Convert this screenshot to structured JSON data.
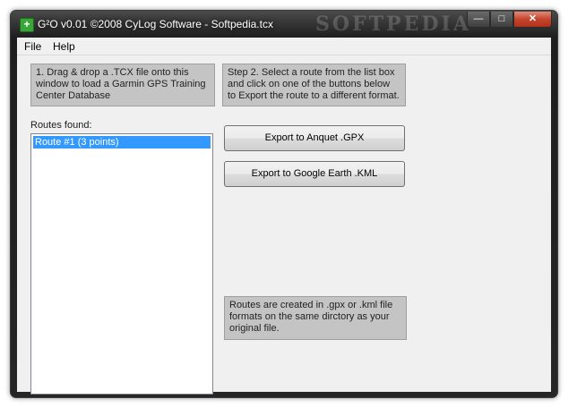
{
  "window": {
    "title": "G²O v0.01 ©2008 CyLog Software - Softpedia.tcx",
    "watermark": "SOFTPEDIA"
  },
  "menu": {
    "items": [
      {
        "label": "File"
      },
      {
        "label": "Help"
      }
    ]
  },
  "step1": {
    "text": "1. Drag & drop a .TCX file onto this window to load a Garmin GPS Training Center Database"
  },
  "step2": {
    "text": "Step 2. Select a route from the list box and click on one of the buttons below to Export the route to a different format."
  },
  "routes": {
    "label": "Routes found:",
    "items": [
      {
        "label": "Route #1 (3 points)",
        "selected": true
      }
    ]
  },
  "buttons": {
    "export_gpx": "Export to Anquet .GPX",
    "export_kml": "Export to Google Earth .KML"
  },
  "info": {
    "text": "Routes are created in .gpx or .kml file formats on the same dirctory as your original file."
  },
  "icons": {
    "app": "app-cross-icon",
    "minimize": "minimize-icon",
    "maximize": "maximize-icon",
    "close": "close-icon"
  }
}
